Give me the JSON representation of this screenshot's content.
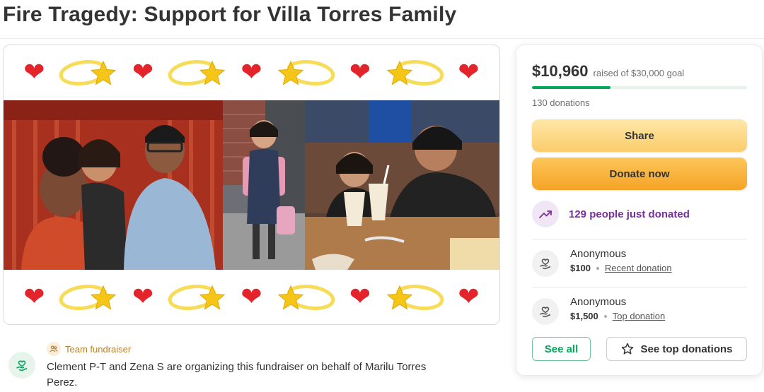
{
  "page": {
    "title": "Fire Tragedy: Support for Villa Torres Family"
  },
  "hero": {
    "decoration_top": [
      "heart",
      "comet",
      "heart",
      "comet",
      "heart",
      "comet",
      "heart",
      "comet",
      "heart"
    ],
    "decoration_bottom": [
      "heart",
      "comet",
      "heart",
      "comet",
      "heart",
      "comet",
      "heart",
      "comet",
      "heart"
    ],
    "heart_glyph": "❤",
    "colors": {
      "heart": "#e3242b",
      "star": "#f5c518",
      "ring": "#f7dc5a"
    }
  },
  "organizer": {
    "team_label": "Team fundraiser",
    "text": "Clement P-T and Zena S are organizing this fundraiser on behalf of Marilu Torres Perez.",
    "avatar_icon": "heart-hand-icon",
    "team_icon": "people-icon"
  },
  "donation_card": {
    "raised_amount": "$10,960",
    "raised_goal": "raised of $30,000 goal",
    "progress_fraction": 0.365,
    "donation_count": "130 donations",
    "share_label": "Share",
    "donate_label": "Donate now",
    "momentum_text": "129 people just donated",
    "momentum_icon": "trending-up-icon",
    "donors": [
      {
        "name": "Anonymous",
        "amount": "$100",
        "tag": "Recent donation"
      },
      {
        "name": "Anonymous",
        "amount": "$1,500",
        "tag": "Top donation"
      }
    ],
    "see_all_label": "See all",
    "see_top_label": "See top donations",
    "colors": {
      "accent_green": "#02a95c",
      "momentum_purple": "#7a2d9c",
      "donate_orange": "#f5a326"
    }
  }
}
